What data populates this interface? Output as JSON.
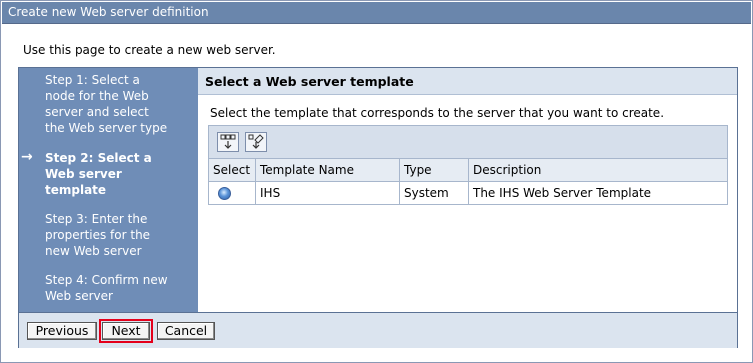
{
  "window": {
    "title": "Create new Web server definition"
  },
  "intro_text": "Use this page to create a new web server.",
  "steps": [
    {
      "label": "Step 1: Select a node for the Web server and select the Web server type",
      "current": false
    },
    {
      "label": "Step 2: Select a Web server template",
      "current": true
    },
    {
      "label": "Step 3: Enter the properties for the new Web server",
      "current": false
    },
    {
      "label": "Step 4: Confirm new Web server",
      "current": false
    }
  ],
  "current_step_arrow": "→",
  "content": {
    "header": "Select a Web server template",
    "description": "Select the template that corresponds to the server that you want to create.",
    "toolbar_icons": [
      "select-all-icon",
      "deselect-all-icon"
    ],
    "table": {
      "columns": [
        "Select",
        "Template Name",
        "Type",
        "Description"
      ],
      "rows": [
        {
          "selected": true,
          "name": "IHS",
          "type": "System",
          "description": "The IHS Web Server Template"
        }
      ]
    }
  },
  "buttons": {
    "previous": "Previous",
    "next": "Next",
    "cancel": "Cancel"
  },
  "colors": {
    "title_bar": "#6a86ac",
    "steps_panel": "#6f8db7",
    "header_band": "#dbe4ef",
    "highlight": "#e4001b"
  }
}
